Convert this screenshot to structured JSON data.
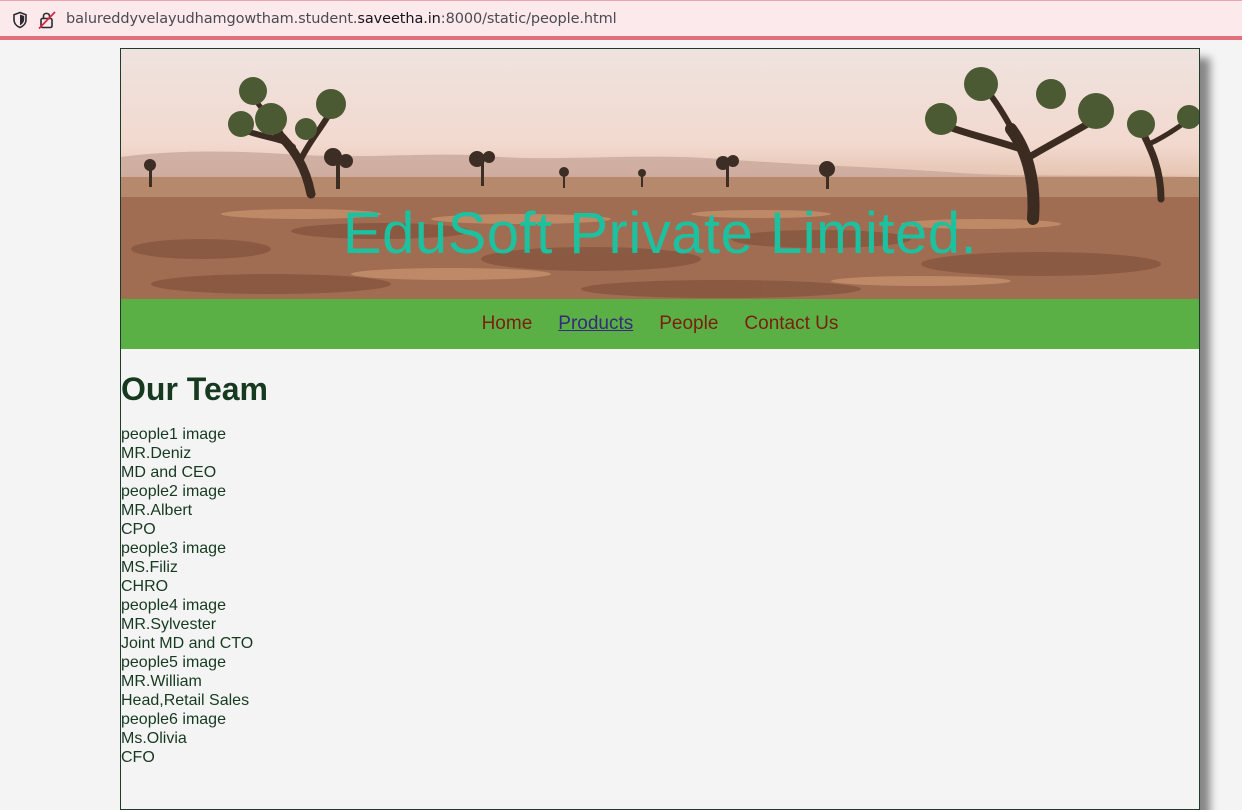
{
  "browser": {
    "url_prefix": "balureddyvelayudhamgowtham.student.",
    "url_host": "saveetha.in",
    "url_suffix": ":8000/static/people.html"
  },
  "banner": {
    "company_name": "EduSoft Private Limited."
  },
  "nav": {
    "items": [
      {
        "label": "Home"
      },
      {
        "label": "Products"
      },
      {
        "label": "People"
      },
      {
        "label": "Contact Us"
      }
    ]
  },
  "main": {
    "heading": "Our Team",
    "people": [
      {
        "image_alt": "people1 image",
        "name": "MR.Deniz",
        "role": "MD and CEO"
      },
      {
        "image_alt": "people2 image",
        "name": "MR.Albert",
        "role": "CPO"
      },
      {
        "image_alt": "people3 image",
        "name": "MS.Filiz",
        "role": "CHRO"
      },
      {
        "image_alt": "people4 image",
        "name": "MR.Sylvester",
        "role": "Joint MD and CTO"
      },
      {
        "image_alt": "people5 image",
        "name": "MR.William",
        "role": "Head,Retail Sales"
      },
      {
        "image_alt": "people6 image",
        "name": "Ms.Olivia",
        "role": "CFO"
      }
    ]
  },
  "colors": {
    "nav_background": "#5ab045",
    "nav_link": "#7a1e0f",
    "nav_link_visited": "#352a7c",
    "company_name": "#1cc1a0",
    "text": "#163a20"
  },
  "icons": {
    "tracking": "shield-icon",
    "security": "lock-icon"
  }
}
